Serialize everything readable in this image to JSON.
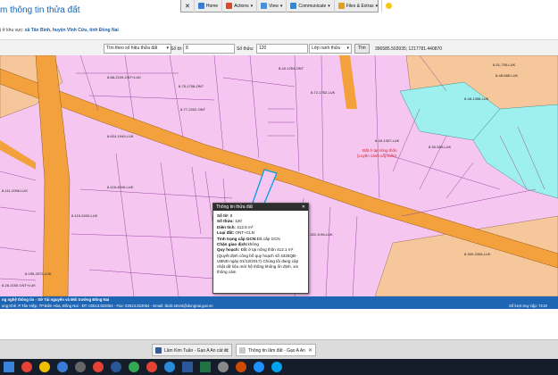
{
  "header": {
    "title": "m thông tin thửa đất",
    "location_prefix": "ị ở khu vực: ",
    "location_value": "xã Tân Bình, huyện Vĩnh Cửu, tỉnh Đồng Nai"
  },
  "remote_toolbar": {
    "close": "✕",
    "home": "Home",
    "actions": "Actions",
    "view": "View",
    "communicate": "Communicate",
    "files": "Files & Extras"
  },
  "search": {
    "mode": "Tìm theo số hiệu thửa đất",
    "sheet_label": "Số tờ:",
    "sheet_value": "8",
    "parcel_label": "Số thửa:",
    "parcel_value": "120",
    "layer": "Lớp ranh thửa",
    "button": "Tìm",
    "coords": "396585.503935; 1217781.440870"
  },
  "map": {
    "parcels": [
      "8-68-2100-CNT+LUK",
      "8-75-1708-ONT",
      "8-43-1254-ONT",
      "8-72-1762-LUK",
      "8-77-2202-ONT",
      "8-624-1949-LUK",
      "8-116-4040-LUK",
      "8-115-3400-LUK",
      "8-51-795-LUK",
      "8-48-685-LUK",
      "8-48-1358-LUK",
      "8-49-1307-LUK",
      "8-155-2972-LUK",
      "8-111-2096-LUK",
      "8-322-9-96-LUK",
      "8-300-2306-LUK",
      "8-30-585-LUK",
      "8-26-2150-CNT+LUK"
    ],
    "note_line1": "Đất ở tại nông thôn",
    "note_line2": "(Luyện cánh cây kiến)"
  },
  "popup": {
    "title": "Thông tin thửa đất",
    "close": "✕",
    "sheet_label": "Số tờ:",
    "sheet_value": "8",
    "parcel_label": "Số thửa:",
    "parcel_value": "120",
    "area_label": "Diện tích:",
    "area_value": "412.5 m²",
    "landtype_label": "Loại đất:",
    "landtype_value": "ONT+CLN",
    "gcn_label": "Tình trạng cấp GCN:",
    "gcn_value": "Đã cấp GCN",
    "transaction_label": "Chặn giao dịch:",
    "transaction_value": "không",
    "planning_label": "Quy hoạch:",
    "planning_value": "Đất ở tại nông thôn 412.1 m²",
    "decision_text": "(Quyết định công bố quy hoạch số 4326QĐ-UBND ngày 01/12/2017) Chúng tôi đang cập nhật dữ liệu mới hệ thống không ổn định, xin thông cảm"
  },
  "footer": {
    "line1": "ng nghệ thông tin - Sở Tài nguyên và Môi trường Đồng Nai",
    "line2": "ung Khê, P.Tân Hiệp, TP.Biên Hòa, Đồng Nai - ĐT: 02513.822054 - Fax: 02513.823054 - Email: tbcitt.stnmt@dongnai.gov.vn",
    "visits": "Số lượt truy cập: 7219"
  },
  "tabs": [
    {
      "label": "Lâm Kim Tuấn - Gạo A An cát cc",
      "close": "✕"
    },
    {
      "label": "Thông tin lâm đất - Gạo A An",
      "close": "✕"
    }
  ],
  "colors": {
    "road": "#f2a13c",
    "parcel_pink": "#f5c6f0",
    "agri_orange": "#f6c79a",
    "teal": "#9ef0ef",
    "header_blue": "#1565b5",
    "footer_blue": "#1e66b3"
  }
}
